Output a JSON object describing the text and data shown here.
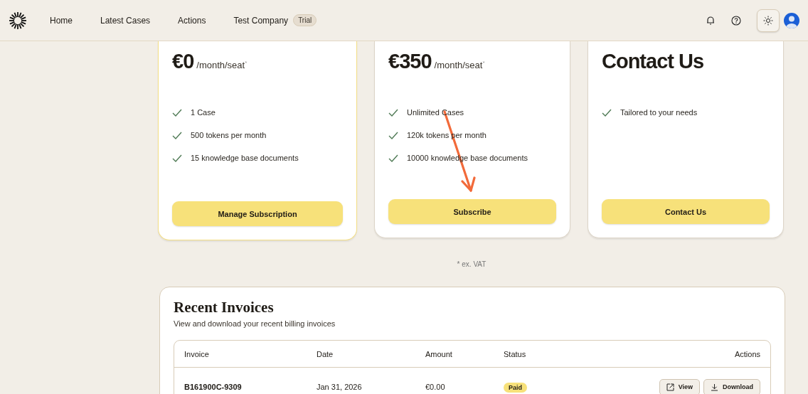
{
  "header": {
    "nav": [
      {
        "label": "Home"
      },
      {
        "label": "Latest Cases"
      },
      {
        "label": "Actions"
      },
      {
        "label": "Test Company",
        "badge": "Trial"
      }
    ]
  },
  "plans": [
    {
      "kind": "price",
      "price": "€0",
      "period": "/month/seat$^{*}$",
      "current": true,
      "features": [
        "1 Case",
        "500 tokens per month",
        "15 knowledge base documents"
      ],
      "button": "Manage Subscription"
    },
    {
      "kind": "price",
      "price": "€350",
      "period": "/month/seat$^{*}$",
      "current": false,
      "features": [
        "Unlimited Cases",
        "120k tokens per month",
        "10000 knowledge base documents"
      ],
      "button": "Subscribe"
    },
    {
      "kind": "title",
      "title": "Contact Us",
      "current": false,
      "features": [
        "Tailored to your needs"
      ],
      "button": "Contact Us"
    }
  ],
  "footnote": "* ex. VAT",
  "invoices": {
    "title": "Recent Invoices",
    "subtitle": "View and download your recent billing invoices",
    "columns": [
      "Invoice",
      "Date",
      "Amount",
      "Status",
      "Actions"
    ],
    "rows": [
      {
        "invoice": "B161900C-9309",
        "date": "Jan 31, 2026",
        "amount": "€0.00",
        "status": "Paid",
        "actions": [
          "View",
          "Download"
        ]
      }
    ]
  }
}
